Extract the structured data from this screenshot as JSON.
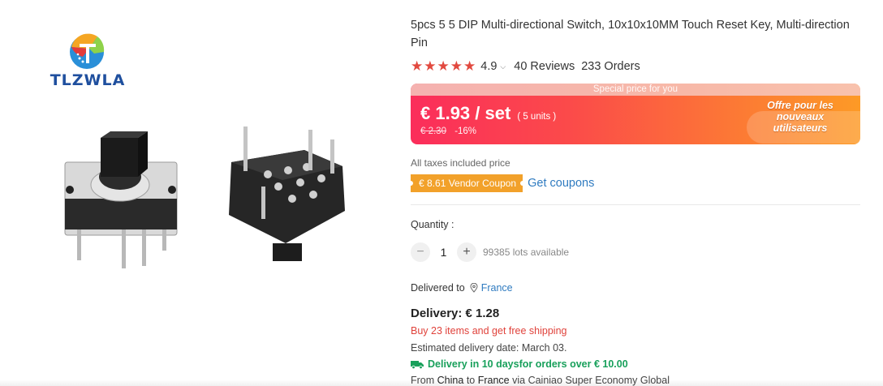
{
  "brand": {
    "name": "TLZWLA",
    "logo_icon": "brand-logo-icon"
  },
  "product": {
    "title": "5pcs 5 5 DIP Multi-directional Switch, 10x10x10MM Touch Reset Key, Multi-direction Pin",
    "rating": {
      "stars": 5,
      "value": "4.9",
      "reviews": "40 Reviews",
      "orders": "233 Orders"
    },
    "price": {
      "special_label": "Special price for you",
      "current": "€ 1.93 / set",
      "units": "( 5 units )",
      "original": "€ 2.30",
      "discount": "-16%",
      "promo": "Offre pour les nouveaux utilisateurs",
      "accent_color": "#fb2d5b"
    },
    "taxes": "All taxes included price",
    "coupon": {
      "label": "€ 8.61 Vendor Coupon",
      "link": "Get coupons"
    },
    "quantity": {
      "label": "Quantity :",
      "value": "1",
      "available": "99385 lots available",
      "minus": "−",
      "plus": "+"
    },
    "shipping": {
      "delivered_to_label": "Delivered to",
      "country": "France",
      "delivery": "Delivery: € 1.28",
      "free_shipping": "Buy 23 items and get free shipping",
      "estimated_label": "Estimated delivery date:",
      "estimated_date": "March 03.",
      "fast_delivery": "Delivery in 10 daysfor orders over € 10.00",
      "from_prefix": "From",
      "from_country": "China",
      "to_word": "to",
      "to_country": "France",
      "via": "via Cainiao Super Economy Global"
    }
  }
}
